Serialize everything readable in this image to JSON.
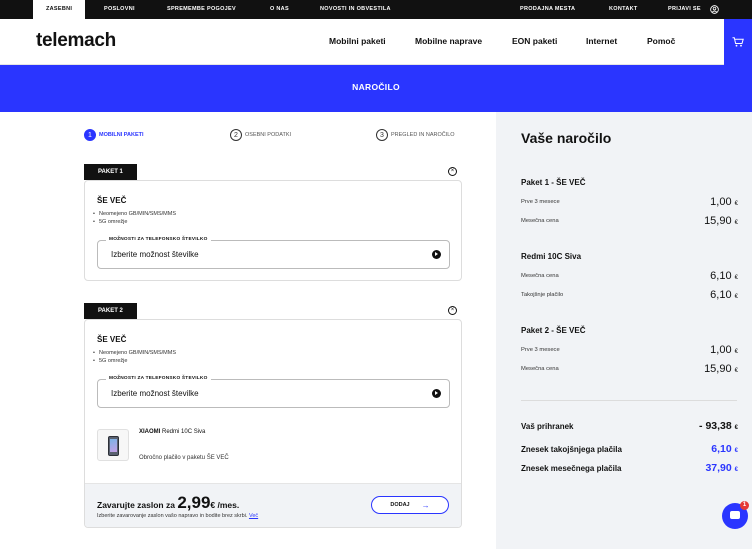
{
  "topbar": {
    "left": [
      "ZASEBNI",
      "POSLOVNI",
      "SPREMEMBE POGOJEV",
      "O NAS",
      "NOVOSTI IN OBVESTILA"
    ],
    "right": [
      "PRODAJNA MESTA",
      "KONTAKT",
      "PRIJAVI SE"
    ]
  },
  "header": {
    "logo": "telemach",
    "nav": [
      "Mobilni paketi",
      "Mobilne naprave",
      "EON paketi",
      "Internet",
      "Pomoč"
    ]
  },
  "banner": {
    "title": "NAROČILO"
  },
  "steps": [
    {
      "num": "1",
      "label": "MOBILNI PAKETI"
    },
    {
      "num": "2",
      "label": "OSEBNI PODATKI"
    },
    {
      "num": "3",
      "label": "PREGLED IN NAROČILO"
    }
  ],
  "packages": [
    {
      "tag": "PAKET 1",
      "plan": "ŠE VEČ",
      "features": [
        "Neomejeno GB/MIN/SMS/MMS",
        "5G omrežje"
      ],
      "select_label": "MOŽNOSTI ZA TELEFONSKO ŠTEVILKO",
      "select_value": "Izberite možnost številke"
    },
    {
      "tag": "PAKET 2",
      "plan": "ŠE VEČ",
      "features": [
        "Neomejeno GB/MIN/SMS/MMS",
        "5G omrežje"
      ],
      "select_label": "MOŽNOSTI ZA TELEFONSKO ŠTEVILKO",
      "select_value": "Izberite možnost številke",
      "device_brand": "XIAOMI",
      "device_name": "Redmi 10C Siva",
      "device_note": "Obročno plačilo v paketu ŠE VEČ"
    }
  ],
  "insurance": {
    "prefix": "Zavarujte zaslon za",
    "price": "2,99",
    "suffix": "€ /mes.",
    "desc": "Izberite zavarovanje zaslon vašo napravo in bodite brez skrbi.",
    "link": "Več",
    "button": "DODAJ"
  },
  "summary": {
    "title": "Vaše naročilo",
    "sections": [
      {
        "title": "Paket 1 - ŠE VEČ",
        "rows": [
          {
            "label": "Prve 3 mesece",
            "value": "1,00"
          },
          {
            "label": "Mesečna cena",
            "value": "15,90"
          }
        ]
      },
      {
        "title": "Redmi 10C Siva",
        "rows": [
          {
            "label": "Mesečna cena",
            "value": "6,10"
          },
          {
            "label": "Takojšnje plačilo",
            "value": "6,10"
          }
        ]
      },
      {
        "title": "Paket 2 - ŠE VEČ",
        "rows": [
          {
            "label": "Prve 3 mesece",
            "value": "1,00"
          },
          {
            "label": "Mesečna cena",
            "value": "15,90"
          }
        ]
      }
    ],
    "totals": [
      {
        "label": "Vaš prihranek",
        "value": "- 93,38"
      },
      {
        "label": "Znesek takojšnjega plačila",
        "value": "6,10"
      },
      {
        "label": "Znesek mesečnega plačila",
        "value": "37,90"
      }
    ],
    "currency": "€"
  },
  "chat": {
    "badge": "1"
  },
  "colors": {
    "accent": "#2a35ff",
    "dark": "#111111",
    "panel": "#f1f3f6"
  }
}
